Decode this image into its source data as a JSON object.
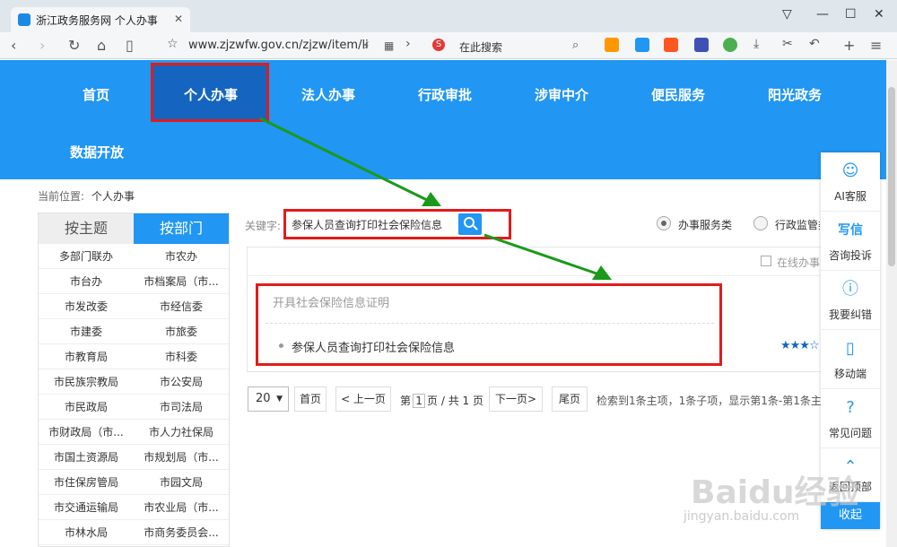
{
  "browser": {
    "tab_title": "浙江政务服务网 个人办事",
    "url": "www.zjzwfw.gov.cn/zjzw/item/li",
    "search_placeholder": "在此搜索"
  },
  "nav": {
    "items": [
      "首页",
      "个人办事",
      "法人办事",
      "行政审批",
      "涉审中介",
      "便民服务",
      "阳光政务",
      "数据开放"
    ]
  },
  "breadcrumb": {
    "label": "当前位置:",
    "current": "个人办事"
  },
  "dept_panel": {
    "tab_theme": "按主题",
    "tab_dept": "按部门",
    "departments": [
      [
        "多部门联办",
        "市农办"
      ],
      [
        "市台办",
        "市档案局（市..."
      ],
      [
        "市发改委",
        "市经信委"
      ],
      [
        "市建委",
        "市旅委"
      ],
      [
        "市教育局",
        "市科委"
      ],
      [
        "市民族宗教局",
        "市公安局"
      ],
      [
        "市民政局",
        "市司法局"
      ],
      [
        "市财政局（市...",
        "市人力社保局"
      ],
      [
        "市国土资源局",
        "市规划局（市..."
      ],
      [
        "市住保房管局",
        "市园文局"
      ],
      [
        "市交通运输局",
        "市农业局（市..."
      ],
      [
        "市林水局",
        "市商务委员会..."
      ]
    ]
  },
  "search": {
    "keyword_label": "关键字:",
    "value": "参保人员查询打印社会保险信息",
    "radio_service": "办事服务类",
    "radio_supervision": "行政监管类"
  },
  "results": {
    "online_label": "在线办事",
    "title": "开具社会保险信息证明",
    "item": "参保人员查询打印社会保险信息",
    "stars": "★★★☆"
  },
  "pagination": {
    "page_size": "20",
    "first": "首页",
    "prev": "< 上一页",
    "info_prefix": "第",
    "current_page": "1",
    "info_suffix": "页 / 共 1 页",
    "next": "下一页>",
    "last": "尾页",
    "summary": "检索到1条主项，1条子项，显示第1条-第1条主项"
  },
  "float_panel": {
    "items": [
      {
        "icon": "robot-icon",
        "label": "AI客服"
      },
      {
        "icon": "write-icon",
        "label": "咨询投诉"
      },
      {
        "icon": "info-icon",
        "label": "我要纠错"
      },
      {
        "icon": "phone-icon",
        "label": "移动端"
      },
      {
        "icon": "question-icon",
        "label": "常见问题"
      },
      {
        "icon": "top-arrow-icon",
        "label": "返回顶部"
      }
    ],
    "collapse": "收起"
  },
  "watermark": {
    "main": "Baidu经验",
    "sub": "jingyan.baidu.com"
  },
  "colors": {
    "primary": "#2196f3",
    "active": "#1565c0",
    "highlight": "#e21b1b"
  }
}
